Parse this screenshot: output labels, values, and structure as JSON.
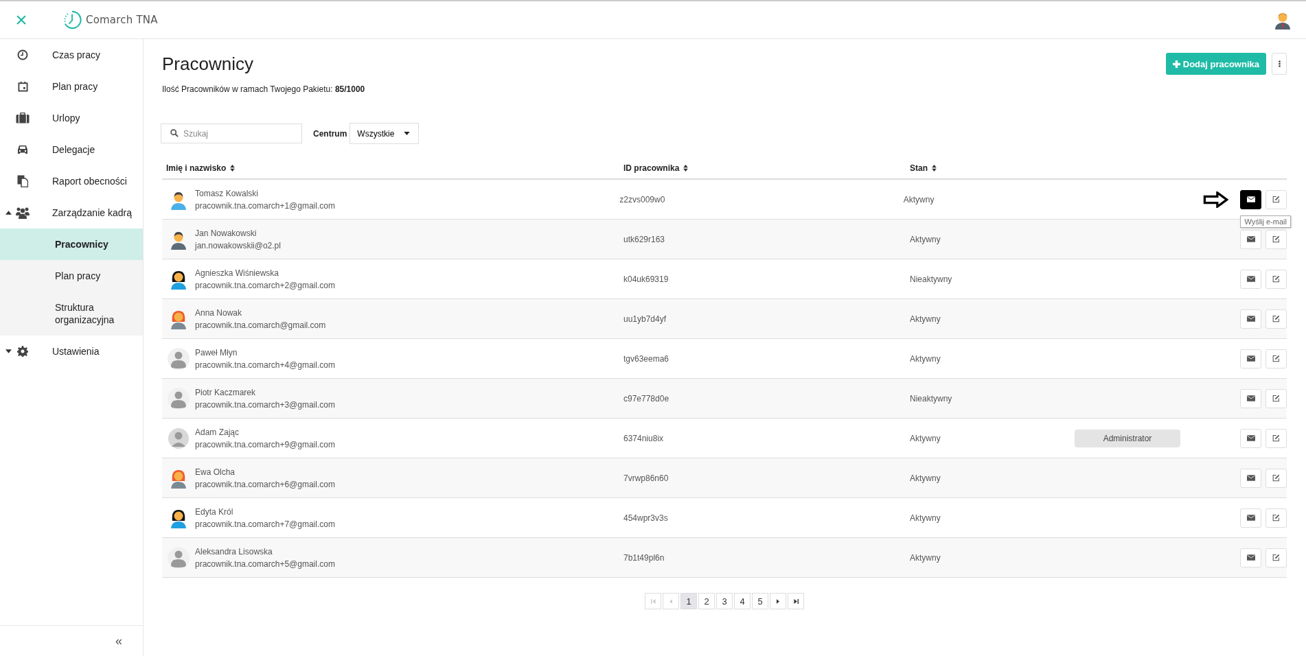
{
  "header": {
    "close": "×",
    "logo": "Comarch TNA"
  },
  "sidebar": {
    "items": [
      {
        "label": "Czas pracy",
        "selected": false
      },
      {
        "label": "Plan pracy",
        "selected": false
      },
      {
        "label": "Urlopy",
        "selected": false
      },
      {
        "label": "Delegacje",
        "selected": false
      },
      {
        "label": "Raport obecności",
        "selected": false
      },
      {
        "label": "Zarządzanie kadrą",
        "selected": false,
        "expanded": true,
        "children": [
          {
            "label": "Pracownicy",
            "selected": true
          },
          {
            "label": "Plan pracy",
            "selected": false
          },
          {
            "label": "Struktura organizacyjna",
            "selected": false
          }
        ]
      },
      {
        "label": "Ustawienia",
        "selected": false,
        "expanded": false
      }
    ],
    "collapse": "«"
  },
  "page": {
    "title": "Pracownicy",
    "quota_label": "Ilość Pracowników w ramach Twojego Pakietu:",
    "quota_value": "85/1000",
    "add_button": "Dodaj pracownika"
  },
  "filters": {
    "search": {
      "placeholder": "Szukaj"
    },
    "center_label": "Centrum",
    "center_value": "Wszystkie"
  },
  "table": {
    "columns": [
      "Imię i nazwisko",
      "ID pracownika",
      "Stan"
    ],
    "rows": [
      {
        "name": "Tomasz Kowalski",
        "email": "pracownik.tna.comarch+1@gmail.com",
        "id": "z2zvs009w0",
        "status": "Aktywny",
        "highlighted": true,
        "tooltip": "Wyślij e-mail"
      },
      {
        "name": "Jan Nowakowski",
        "email": "jan.nowakowskii@o2.pl",
        "id": "utk629r163",
        "status": "Aktywny",
        "highlighted": false
      },
      {
        "name": "Agnieszka Wiśniewska",
        "email": "pracownik.tna.comarch+2@gmail.com",
        "id": "k04uk69319",
        "status": "Nieaktywny",
        "highlighted": false
      },
      {
        "name": "Anna Nowak",
        "email": "pracownik.tna.comarch@gmail.com",
        "id": "uu1yb7d4yf",
        "status": "Aktywny",
        "highlighted": false
      },
      {
        "name": "Paweł Młyn",
        "email": "pracownik.tna.comarch+4@gmail.com",
        "id": "tgv63eema6",
        "status": "Aktywny",
        "highlighted": false
      },
      {
        "name": "Piotr Kaczmarek",
        "email": "pracownik.tna.comarch+3@gmail.com",
        "id": "c97e778d0e",
        "status": "Nieaktywny",
        "highlighted": false
      },
      {
        "name": "Adam Zając",
        "email": "pracownik.tna.comarch+9@gmail.com",
        "id": "6374niu8ix",
        "status": "Aktywny",
        "role": "Administrator",
        "highlighted": false
      },
      {
        "name": "Ewa Olcha",
        "email": "pracownik.tna.comarch+6@gmail.com",
        "id": "7vrwp86n60",
        "status": "Aktywny",
        "highlighted": false
      },
      {
        "name": "Edyta Król",
        "email": "pracownik.tna.comarch+7@gmail.com",
        "id": "454wpr3v3s",
        "status": "Aktywny",
        "highlighted": false
      },
      {
        "name": "Aleksandra Lisowska",
        "email": "pracownik.tna.comarch+5@gmail.com",
        "id": "7b1t49pl6n",
        "status": "Aktywny",
        "highlighted": false
      }
    ]
  },
  "pagination": {
    "first_disabled": true,
    "prev_disabled": true,
    "pages": [
      {
        "label": "1",
        "selected": true
      },
      {
        "label": "2",
        "selected": false
      },
      {
        "label": "3",
        "selected": false
      },
      {
        "label": "4",
        "selected": false
      },
      {
        "label": "5",
        "selected": false
      }
    ]
  }
}
